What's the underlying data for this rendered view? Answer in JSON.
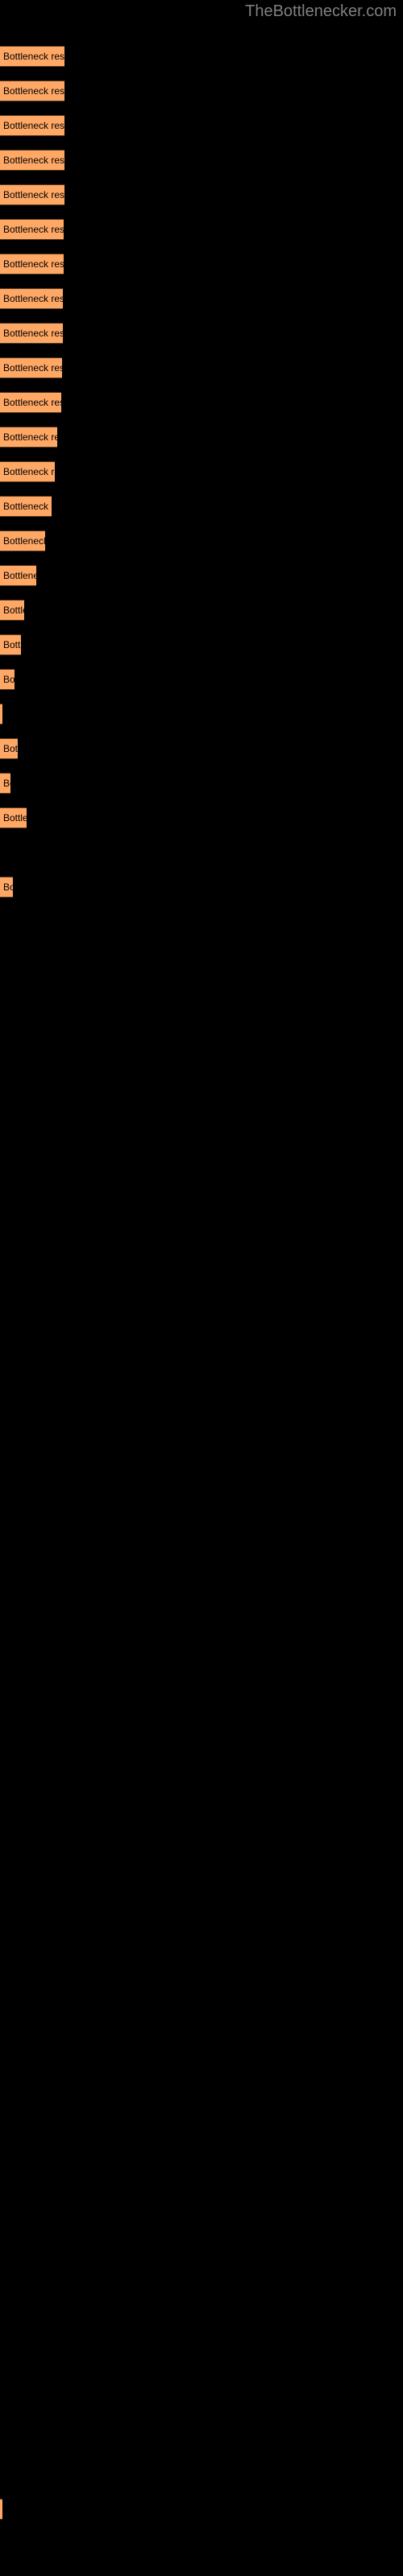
{
  "header": {
    "site_title": "TheBottlenecker.com"
  },
  "colors": {
    "background": "#000000",
    "bar_fill": "#ffa866",
    "bar_border": "#5a3a1e",
    "title_text": "#808080",
    "label_text": "#000000"
  },
  "chart_data": {
    "type": "bar",
    "orientation": "horizontal",
    "title": "TheBottlenecker.com",
    "xlabel": "",
    "ylabel": "",
    "grid": false,
    "legend": "none",
    "bar_label_text": "Bottleneck result",
    "xlim": [
      0,
      500
    ],
    "categories": [
      "Bottleneck result",
      "Bottleneck result",
      "Bottleneck result",
      "Bottleneck result",
      "Bottleneck result",
      "Bottleneck result",
      "Bottleneck result",
      "Bottleneck result",
      "Bottleneck result",
      "Bottleneck result",
      "Bottleneck result",
      "Bottleneck result",
      "Bottleneck result",
      "Bottleneck result",
      "Bottleneck result",
      "Bottleneck result",
      "Bottleneck result",
      "Bottleneck result",
      "Bottleneck result",
      "Bottleneck result",
      "Bottleneck result",
      "Bottleneck result",
      "Bottleneck result",
      "Bottleneck result"
    ],
    "values": [
      80,
      80,
      80,
      80,
      80,
      79,
      79,
      78,
      78,
      77,
      76,
      71,
      68,
      64,
      56,
      45,
      30,
      26,
      18,
      3,
      22,
      13,
      33,
      16
    ],
    "bars": [
      {
        "label": "Bottleneck result",
        "top": 57,
        "width": 80
      },
      {
        "label": "Bottleneck result",
        "top": 100,
        "width": 80
      },
      {
        "label": "Bottleneck result",
        "top": 143,
        "width": 80
      },
      {
        "label": "Bottleneck result",
        "top": 186,
        "width": 80
      },
      {
        "label": "Bottleneck result",
        "top": 229,
        "width": 80
      },
      {
        "label": "Bottleneck result",
        "top": 272,
        "width": 79
      },
      {
        "label": "Bottleneck result",
        "top": 315,
        "width": 79
      },
      {
        "label": "Bottleneck result",
        "top": 358,
        "width": 78
      },
      {
        "label": "Bottleneck result",
        "top": 401,
        "width": 78
      },
      {
        "label": "Bottleneck result",
        "top": 444,
        "width": 77
      },
      {
        "label": "Bottleneck result",
        "top": 487,
        "width": 76
      },
      {
        "label": "Bottleneck result",
        "top": 530,
        "width": 71
      },
      {
        "label": "Bottleneck result",
        "top": 573,
        "width": 68
      },
      {
        "label": "Bottleneck result",
        "top": 616,
        "width": 64
      },
      {
        "label": "Bottleneck result",
        "top": 659,
        "width": 56
      },
      {
        "label": "Bottleneck result",
        "top": 702,
        "width": 45
      },
      {
        "label": "Bottleneck result",
        "top": 745,
        "width": 30
      },
      {
        "label": "Bottleneck result",
        "top": 788,
        "width": 26
      },
      {
        "label": "Bottleneck result",
        "top": 831,
        "width": 18
      },
      {
        "label": "Bottleneck result",
        "top": 874,
        "width": 3
      },
      {
        "label": "Bottleneck result",
        "top": 917,
        "width": 22
      },
      {
        "label": "Bottleneck result",
        "top": 960,
        "width": 13
      },
      {
        "label": "Bottleneck result",
        "top": 1003,
        "width": 33
      },
      {
        "label": "Bottleneck result",
        "top": 1089,
        "width": 16
      },
      {
        "label": "Bottleneck result",
        "top": 3104,
        "width": 3
      }
    ]
  }
}
